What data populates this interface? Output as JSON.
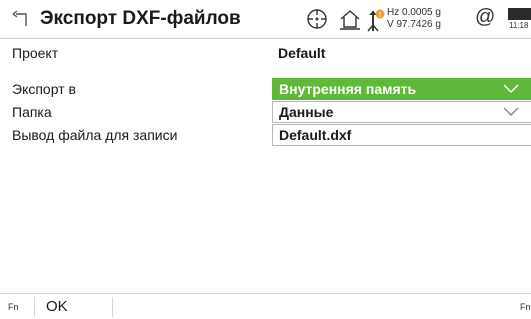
{
  "header": {
    "title": "Экспорт DXF-файлов",
    "hz_line": "Hz 0.0005 g",
    "v_line": "V   97.7426 g",
    "at_symbol": "@",
    "time": "11:18",
    "icons": [
      "back-icon",
      "crosshair-target-icon",
      "home-icon",
      "prism-pole-icon",
      "battery-icon"
    ]
  },
  "form": {
    "project": {
      "label": "Проект",
      "value": "Default"
    },
    "export_to": {
      "label": "Экспорт в",
      "value": "Внутренняя память"
    },
    "folder": {
      "label": "Папка",
      "value": "Данные"
    },
    "output_file": {
      "label": "Вывод файла для записи",
      "value": "Default.dxf"
    }
  },
  "softkeys": {
    "fn_left": "Fn",
    "ok": "OK",
    "fn_right": "Fn"
  },
  "colors": {
    "accent_green": "#5fb83a",
    "badge_orange": "#f0a030"
  }
}
